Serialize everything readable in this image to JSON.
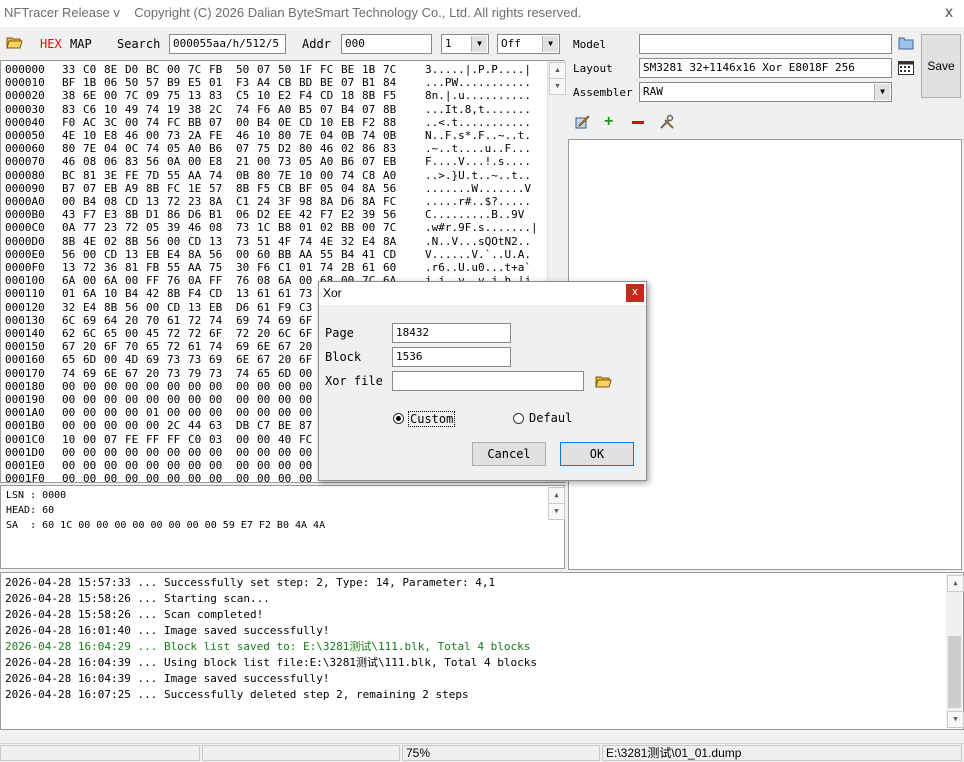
{
  "window": {
    "title": "NFTracer Release v    Copyright (C) 2026 Dalian ByteSmart Technology Co., Ltd. All rights reserved.",
    "close_glyph": "x"
  },
  "toolbar": {
    "hex_label": "HEX",
    "map_label": "MAP",
    "search_label": "Search",
    "search_value": "000055aa/h/512/5",
    "addr_label": "Addr",
    "addr_value": "000",
    "count_value": "1",
    "mode_value": "Off"
  },
  "hex": {
    "rows": [
      {
        "addr": "000000",
        "bytes": [
          "33",
          "C0",
          "8E",
          "D0",
          "BC",
          "00",
          "7C",
          "FB",
          "50",
          "07",
          "50",
          "1F",
          "FC",
          "BE",
          "1B",
          "7C"
        ],
        "ascii": "3.....|.P.P....|"
      },
      {
        "addr": "000010",
        "bytes": [
          "BF",
          "1B",
          "06",
          "50",
          "57",
          "B9",
          "E5",
          "01",
          "F3",
          "A4",
          "CB",
          "BD",
          "BE",
          "07",
          "B1",
          "84"
        ],
        "ascii": "...PW..........."
      },
      {
        "addr": "000020",
        "bytes": [
          "38",
          "6E",
          "00",
          "7C",
          "09",
          "75",
          "13",
          "83",
          "C5",
          "10",
          "E2",
          "F4",
          "CD",
          "18",
          "8B",
          "F5"
        ],
        "ascii": "8n.|.u.........."
      },
      {
        "addr": "000030",
        "bytes": [
          "83",
          "C6",
          "10",
          "49",
          "74",
          "19",
          "38",
          "2C",
          "74",
          "F6",
          "A0",
          "B5",
          "07",
          "B4",
          "07",
          "8B"
        ],
        "ascii": "...It.8,t......."
      },
      {
        "addr": "000040",
        "bytes": [
          "F0",
          "AC",
          "3C",
          "00",
          "74",
          "FC",
          "BB",
          "07",
          "00",
          "B4",
          "0E",
          "CD",
          "10",
          "EB",
          "F2",
          "88"
        ],
        "ascii": "..<.t..........."
      },
      {
        "addr": "000050",
        "bytes": [
          "4E",
          "10",
          "E8",
          "46",
          "00",
          "73",
          "2A",
          "FE",
          "46",
          "10",
          "80",
          "7E",
          "04",
          "0B",
          "74",
          "0B"
        ],
        "ascii": "N..F.s*.F..~..t."
      },
      {
        "addr": "000060",
        "bytes": [
          "80",
          "7E",
          "04",
          "0C",
          "74",
          "05",
          "A0",
          "B6",
          "07",
          "75",
          "D2",
          "80",
          "46",
          "02",
          "86",
          "83"
        ],
        "ascii": ".~..t....u..F..."
      },
      {
        "addr": "000070",
        "bytes": [
          "46",
          "08",
          "06",
          "83",
          "56",
          "0A",
          "00",
          "E8",
          "21",
          "00",
          "73",
          "05",
          "A0",
          "B6",
          "07",
          "EB"
        ],
        "ascii": "F....V...!.s...."
      },
      {
        "addr": "000080",
        "bytes": [
          "BC",
          "81",
          "3E",
          "FE",
          "7D",
          "55",
          "AA",
          "74",
          "0B",
          "80",
          "7E",
          "10",
          "00",
          "74",
          "C8",
          "A0"
        ],
        "ascii": "..>.}U.t..~..t.."
      },
      {
        "addr": "000090",
        "bytes": [
          "B7",
          "07",
          "EB",
          "A9",
          "8B",
          "FC",
          "1E",
          "57",
          "8B",
          "F5",
          "CB",
          "BF",
          "05",
          "04",
          "8A",
          "56"
        ],
        "ascii": ".......W.......V"
      },
      {
        "addr": "0000A0",
        "bytes": [
          "00",
          "B4",
          "08",
          "CD",
          "13",
          "72",
          "23",
          "8A",
          "C1",
          "24",
          "3F",
          "98",
          "8A",
          "D6",
          "8A",
          "FC"
        ],
        "ascii": ".....r#..$?....."
      },
      {
        "addr": "0000B0",
        "bytes": [
          "43",
          "F7",
          "E3",
          "8B",
          "D1",
          "86",
          "D6",
          "B1",
          "06",
          "D2",
          "EE",
          "42",
          "F7",
          "E2",
          "39",
          "56"
        ],
        "ascii": "C.........B..9V"
      },
      {
        "addr": "0000C0",
        "bytes": [
          "0A",
          "77",
          "23",
          "72",
          "05",
          "39",
          "46",
          "08",
          "73",
          "1C",
          "B8",
          "01",
          "02",
          "BB",
          "00",
          "7C"
        ],
        "ascii": ".w#r.9F.s.......|"
      },
      {
        "addr": "0000D0",
        "bytes": [
          "8B",
          "4E",
          "02",
          "8B",
          "56",
          "00",
          "CD",
          "13",
          "73",
          "51",
          "4F",
          "74",
          "4E",
          "32",
          "E4",
          "8A"
        ],
        "ascii": ".N..V...sQOtN2.."
      },
      {
        "addr": "0000E0",
        "bytes": [
          "56",
          "00",
          "CD",
          "13",
          "EB",
          "E4",
          "8A",
          "56",
          "00",
          "60",
          "BB",
          "AA",
          "55",
          "B4",
          "41",
          "CD"
        ],
        "ascii": "V......V.`..U.A."
      },
      {
        "addr": "0000F0",
        "bytes": [
          "13",
          "72",
          "36",
          "81",
          "FB",
          "55",
          "AA",
          "75",
          "30",
          "F6",
          "C1",
          "01",
          "74",
          "2B",
          "61",
          "60"
        ],
        "ascii": ".r6..U.u0...t+a`"
      },
      {
        "addr": "000100",
        "bytes": [
          "6A",
          "00",
          "6A",
          "00",
          "FF",
          "76",
          "0A",
          "FF",
          "76",
          "08",
          "6A",
          "00",
          "68",
          "00",
          "7C",
          "6A"
        ],
        "ascii": "j.j..v..v.j.h.|j"
      },
      {
        "addr": "000110",
        "bytes": [
          "01",
          "6A",
          "10",
          "B4",
          "42",
          "8B",
          "F4",
          "CD",
          "13",
          "61",
          "61",
          "73",
          "",
          "",
          "",
          ""
        ],
        "ascii": ""
      },
      {
        "addr": "000120",
        "bytes": [
          "32",
          "E4",
          "8B",
          "56",
          "00",
          "CD",
          "13",
          "EB",
          "D6",
          "61",
          "F9",
          "C3",
          "",
          "",
          "",
          ""
        ],
        "ascii": ""
      },
      {
        "addr": "000130",
        "bytes": [
          "6C",
          "69",
          "64",
          "20",
          "70",
          "61",
          "72",
          "74",
          "69",
          "74",
          "69",
          "6F",
          "",
          "",
          "",
          ""
        ],
        "ascii": ""
      },
      {
        "addr": "000140",
        "bytes": [
          "62",
          "6C",
          "65",
          "00",
          "45",
          "72",
          "72",
          "6F",
          "72",
          "20",
          "6C",
          "6F",
          "",
          "",
          "",
          ""
        ],
        "ascii": ""
      },
      {
        "addr": "000150",
        "bytes": [
          "67",
          "20",
          "6F",
          "70",
          "65",
          "72",
          "61",
          "74",
          "69",
          "6E",
          "67",
          "20",
          "",
          "",
          "",
          ""
        ],
        "ascii": ""
      },
      {
        "addr": "000160",
        "bytes": [
          "65",
          "6D",
          "00",
          "4D",
          "69",
          "73",
          "73",
          "69",
          "6E",
          "67",
          "20",
          "6F",
          "",
          "",
          "",
          ""
        ],
        "ascii": ""
      },
      {
        "addr": "000170",
        "bytes": [
          "74",
          "69",
          "6E",
          "67",
          "20",
          "73",
          "79",
          "73",
          "74",
          "65",
          "6D",
          "00",
          "",
          "",
          "",
          ""
        ],
        "ascii": ""
      },
      {
        "addr": "000180",
        "bytes": [
          "00",
          "00",
          "00",
          "00",
          "00",
          "00",
          "00",
          "00",
          "00",
          "00",
          "00",
          "00",
          "",
          "",
          "",
          ""
        ],
        "ascii": ""
      },
      {
        "addr": "000190",
        "bytes": [
          "00",
          "00",
          "00",
          "00",
          "00",
          "00",
          "00",
          "00",
          "00",
          "00",
          "00",
          "00",
          "",
          "",
          "",
          ""
        ],
        "ascii": ""
      },
      {
        "addr": "0001A0",
        "bytes": [
          "00",
          "00",
          "00",
          "00",
          "01",
          "00",
          "00",
          "00",
          "00",
          "00",
          "00",
          "00",
          "",
          "",
          "",
          ""
        ],
        "ascii": ""
      },
      {
        "addr": "0001B0",
        "bytes": [
          "00",
          "00",
          "00",
          "00",
          "00",
          "2C",
          "44",
          "63",
          "DB",
          "C7",
          "BE",
          "87",
          "",
          "",
          "",
          ""
        ],
        "ascii": ""
      },
      {
        "addr": "0001C0",
        "bytes": [
          "10",
          "00",
          "07",
          "FE",
          "FF",
          "FF",
          "C0",
          "03",
          "00",
          "00",
          "40",
          "FC",
          "",
          "",
          "",
          ""
        ],
        "ascii": ""
      },
      {
        "addr": "0001D0",
        "bytes": [
          "00",
          "00",
          "00",
          "00",
          "00",
          "00",
          "00",
          "00",
          "00",
          "00",
          "00",
          "00",
          "",
          "",
          "",
          ""
        ],
        "ascii": ""
      },
      {
        "addr": "0001E0",
        "bytes": [
          "00",
          "00",
          "00",
          "00",
          "00",
          "00",
          "00",
          "00",
          "00",
          "00",
          "00",
          "00",
          "",
          "",
          "",
          ""
        ],
        "ascii": ""
      },
      {
        "addr": "0001F0",
        "bytes": [
          "00",
          "00",
          "00",
          "00",
          "00",
          "00",
          "00",
          "00",
          "00",
          "00",
          "00",
          "00",
          "",
          "",
          "",
          ""
        ],
        "ascii": ""
      }
    ]
  },
  "info": {
    "lsn": "LSN : 0000",
    "head": "HEAD: 60",
    "sa": "SA  : 60 1C 00 00 00 00 00 00 00 00 59 E7 F2 B0 4A 4A"
  },
  "right": {
    "model_label": "Model",
    "model_value": "",
    "layout_label": "Layout",
    "layout_value": "SM3281 32+1146x16 Xor E8018F 256",
    "assembler_label": "Assembler",
    "assembler_value": "RAW",
    "save_label": "Save"
  },
  "log": {
    "lines": [
      {
        "text": "2026-04-28 15:57:33 ... Successfully set step: 2, Type: 14, Parameter: 4,1",
        "color": "#000000"
      },
      {
        "text": "2026-04-28 15:58:26 ... Starting scan...",
        "color": "#000000"
      },
      {
        "text": "2026-04-28 15:58:26 ... Scan completed!",
        "color": "#000000"
      },
      {
        "text": "2026-04-28 16:01:40 ... Image saved successfully!",
        "color": "#000000"
      },
      {
        "text": "2026-04-28 16:04:29 ... Block list saved to: E:\\3281测试\\111.blk, Total 4 blocks",
        "color": "#1a7a1a"
      },
      {
        "text": "2026-04-28 16:04:39 ... Using block list file:E:\\3281测试\\111.blk, Total 4 blocks",
        "color": "#000000"
      },
      {
        "text": "2026-04-28 16:04:39 ... Image saved successfully!",
        "color": "#000000"
      },
      {
        "text": "2026-04-28 16:07:25 ... Successfully deleted step 2, remaining 2 steps",
        "color": "#000000"
      }
    ]
  },
  "status": {
    "cell1": "",
    "cell2": "",
    "zoom": "75%",
    "file": "E:\\3281测试\\01_01.dump"
  },
  "dialog": {
    "title": "Xor",
    "close_glyph": "x",
    "page_label": "Page",
    "page_value": "18432",
    "block_label": "Block",
    "block_value": "1536",
    "xorfile_label": "Xor file",
    "xorfile_value": "",
    "radio_custom": "Custom",
    "radio_default": "Defaul",
    "cancel_label": "Cancel",
    "ok_label": "OK"
  }
}
